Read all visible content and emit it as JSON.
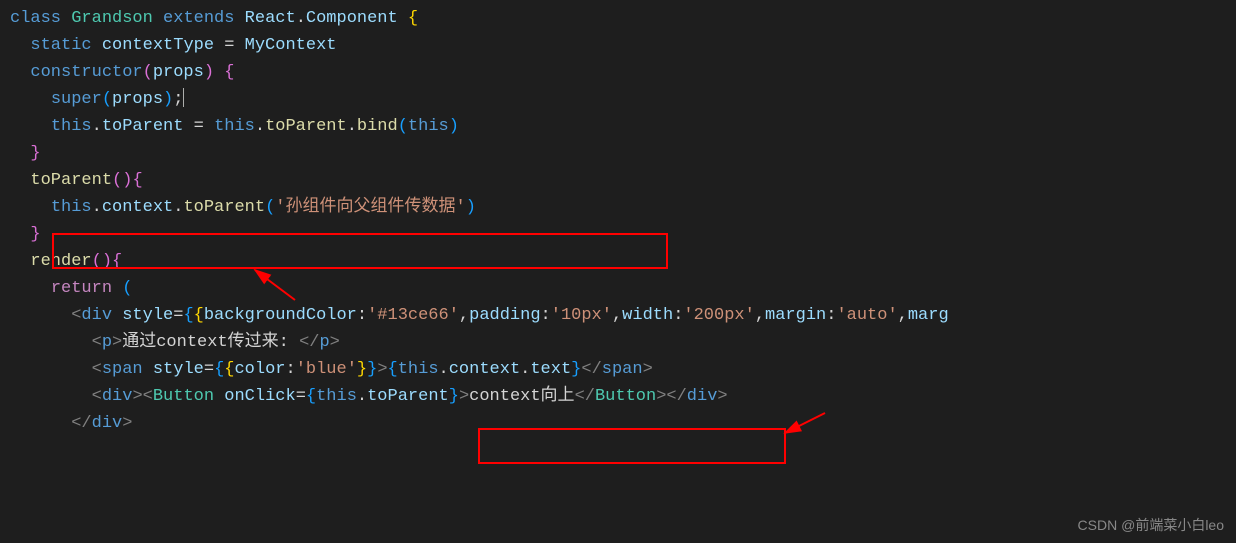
{
  "code": {
    "l1": {
      "class": "class",
      "name": "Grandson",
      "extends": "extends",
      "react": "React",
      "dot": ".",
      "component": "Component",
      "brace": "{"
    },
    "l2": {
      "static": "static",
      "contextType": "contextType",
      "eq": "=",
      "MyContext": "MyContext"
    },
    "l3": {
      "constructor": "constructor",
      "props": "props"
    },
    "l4": {
      "super": "super",
      "props": "props"
    },
    "l5": {
      "this1": "this",
      "toParent1": "toParent",
      "eq": "=",
      "this2": "this",
      "toParent2": "toParent",
      "bind": "bind",
      "this3": "this"
    },
    "l7": {
      "toParent": "toParent"
    },
    "l8": {
      "this": "this",
      "context": "context",
      "toParent": "toParent",
      "str": "'孙组件向父组件传数据'"
    },
    "l10": {
      "render": "render"
    },
    "l11": {
      "return": "return"
    },
    "l12": {
      "div": "div",
      "style": "style",
      "backgroundColor": "backgroundColor",
      "bgVal": "'#13ce66'",
      "padding": "padding",
      "padVal": "'10px'",
      "width": "width",
      "widthVal": "'200px'",
      "margin": "margin",
      "marginVal": "'auto'",
      "marg": "marg"
    },
    "l13": {
      "p": "p",
      "text": "通过context传过来: ",
      "pClose": "p"
    },
    "l14": {
      "span": "span",
      "style": "style",
      "color": "color",
      "colorVal": "'blue'",
      "this": "this",
      "context": "context",
      "text": "text",
      "spanClose": "span"
    },
    "l15": {
      "div": "div",
      "Button": "Button",
      "onClick": "onClick",
      "this": "this",
      "toParent": "toParent",
      "btnText": "context向上",
      "ButtonClose": "Button",
      "divClose": "div"
    },
    "l16": {
      "div": "div"
    }
  },
  "watermark": "CSDN @前端菜小白leo"
}
